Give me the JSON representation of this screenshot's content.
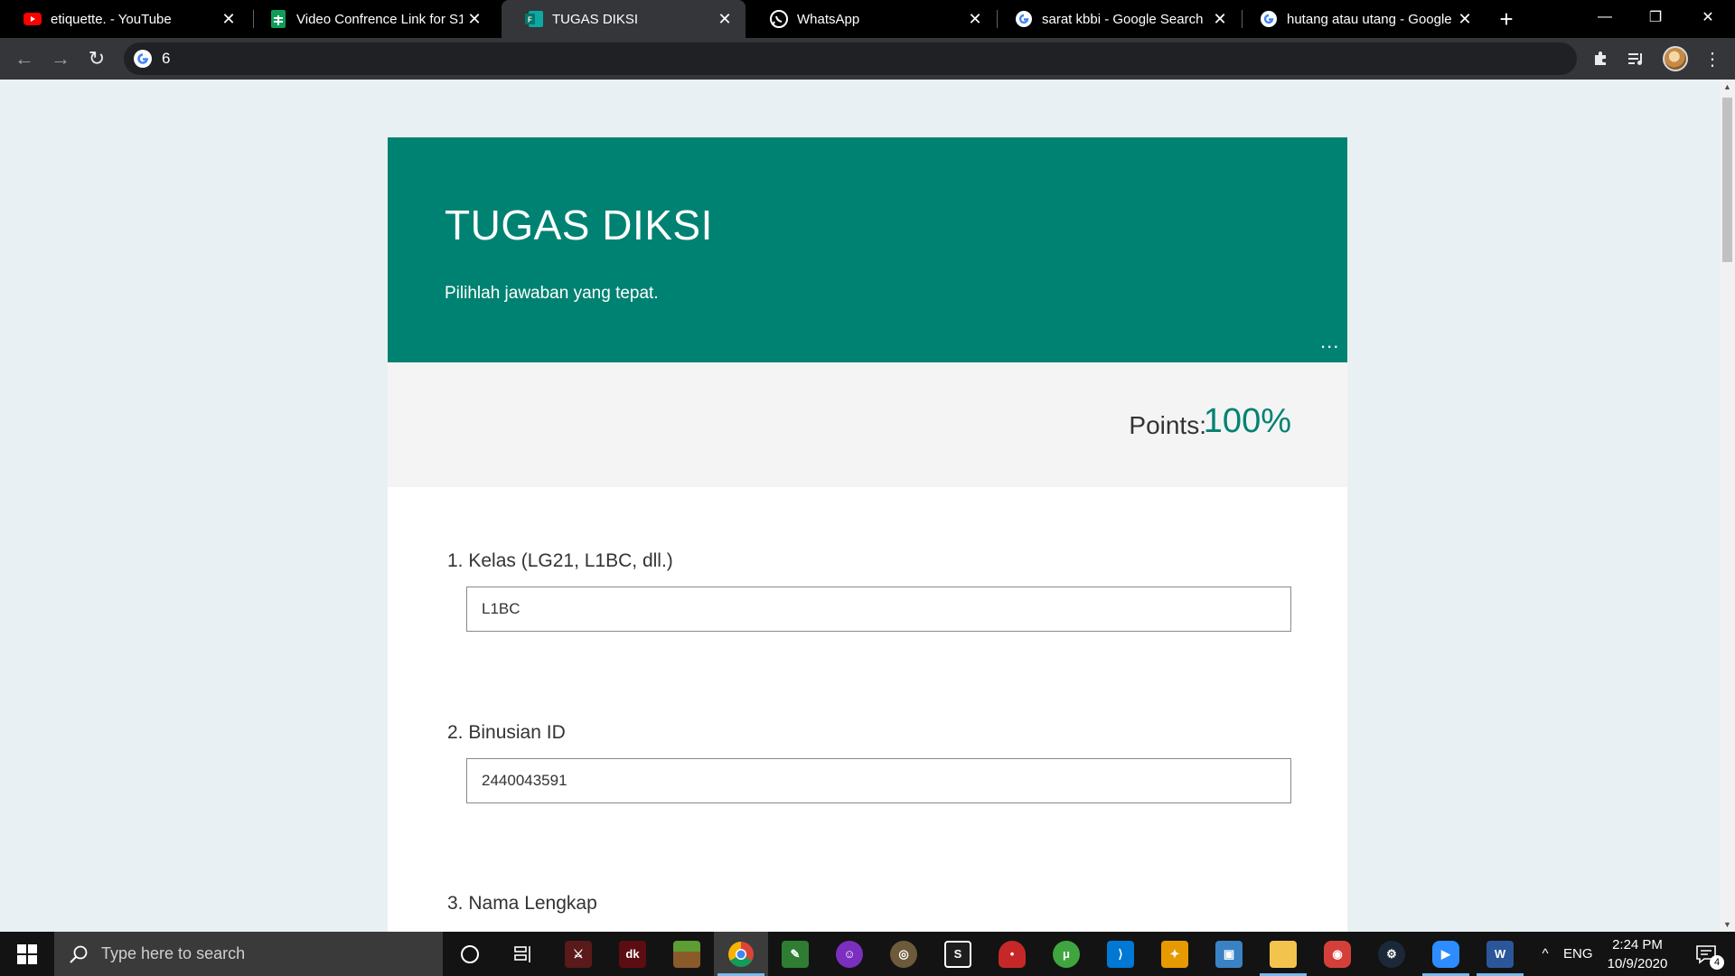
{
  "browser": {
    "tabs": [
      {
        "title": "etiquette. - YouTube",
        "favicon": "youtube-icon",
        "active": false
      },
      {
        "title": "Video Confrence Link for S1 -",
        "favicon": "google-sheets-icon",
        "active": false
      },
      {
        "title": "TUGAS DIKSI",
        "favicon": "microsoft-forms-icon",
        "active": true
      },
      {
        "title": "WhatsApp",
        "favicon": "whatsapp-icon",
        "active": false
      },
      {
        "title": "sarat kbbi - Google Search",
        "favicon": "google-icon",
        "active": false
      },
      {
        "title": "hutang atau utang - Google",
        "favicon": "google-icon",
        "active": false
      }
    ],
    "address": "6"
  },
  "form": {
    "title": "TUGAS DIKSI",
    "description": "Pilihlah jawaban yang tepat.",
    "more_label": "...",
    "points_label": "Points:",
    "points_value": "100%",
    "questions": [
      {
        "label": "1. Kelas (LG21, L1BC, dll.)",
        "answer": "L1BC"
      },
      {
        "label": "2. Binusian ID",
        "answer": "2440043591"
      },
      {
        "label": "3. Nama Lengkap",
        "answer": ""
      }
    ]
  },
  "taskbar": {
    "search_placeholder": "Type here to search",
    "apps": [
      "cortana-icon",
      "task-view-icon",
      "game-icon",
      "dk-icon",
      "minecraft-icon",
      "chrome-icon",
      "notepad-icon",
      "discord-like-icon",
      "league-icon",
      "sublime-icon",
      "mushroom-icon",
      "utorrent-icon",
      "vscode-icon",
      "cs-icon",
      "paint-icon",
      "file-explorer-icon",
      "chat-icon",
      "steam-icon",
      "zoom-icon",
      "word-icon"
    ],
    "language": "ENG",
    "time": "2:24 PM",
    "date": "10/9/2020",
    "notification_count": "4"
  },
  "colors": {
    "accent": "#008272",
    "page_bg": "#e8f0f3",
    "chrome_dark": "#35363a"
  }
}
